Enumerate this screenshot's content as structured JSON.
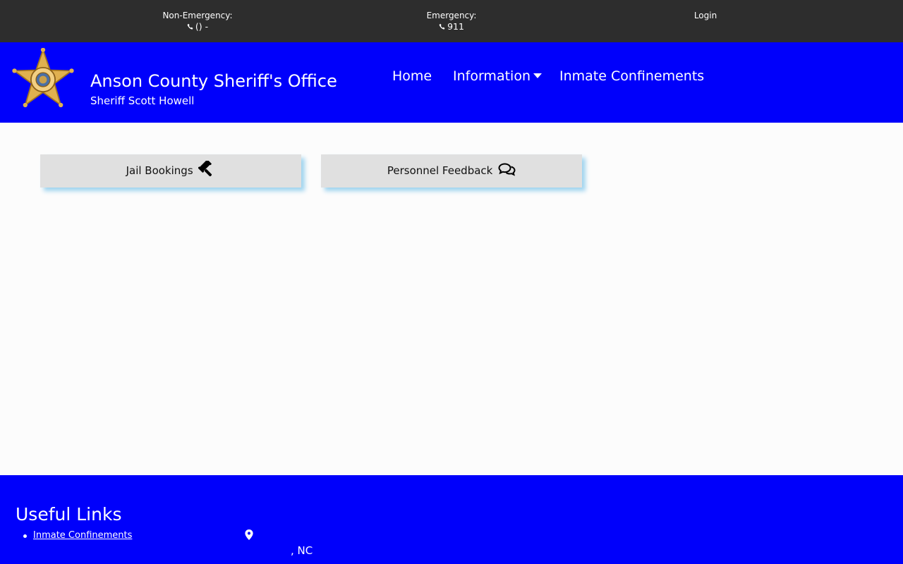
{
  "topbar": {
    "non_emergency_label": "Non-Emergency:",
    "non_emergency_value": "() -",
    "emergency_label": "Emergency:",
    "emergency_value": "911",
    "login_label": "Login",
    "phone_icon": "phone-icon"
  },
  "header": {
    "badge_icon": "sheriff-star-badge",
    "title": "Anson County Sheriff's Office",
    "subtitle": "Sheriff Scott Howell",
    "nav": {
      "home": "Home",
      "information": "Information",
      "inmate": "Inmate Confinements"
    }
  },
  "tiles": [
    {
      "label": "Jail Bookings",
      "icon": "gavel-icon"
    },
    {
      "label": "Personnel Feedback",
      "icon": "comments-icon"
    }
  ],
  "footer": {
    "useful_title": "Useful Links",
    "links": [
      "Inmate Confinements"
    ],
    "location_icon": "map-marker-icon",
    "address_tail": ", NC"
  },
  "colors": {
    "topbar_bg": "#2d2d2d",
    "brand_blue": "#0000fb",
    "tile_bg": "#e0e0e0",
    "tile_shadow": "#9fd4ef",
    "page_bg": "#fcfcfc"
  }
}
